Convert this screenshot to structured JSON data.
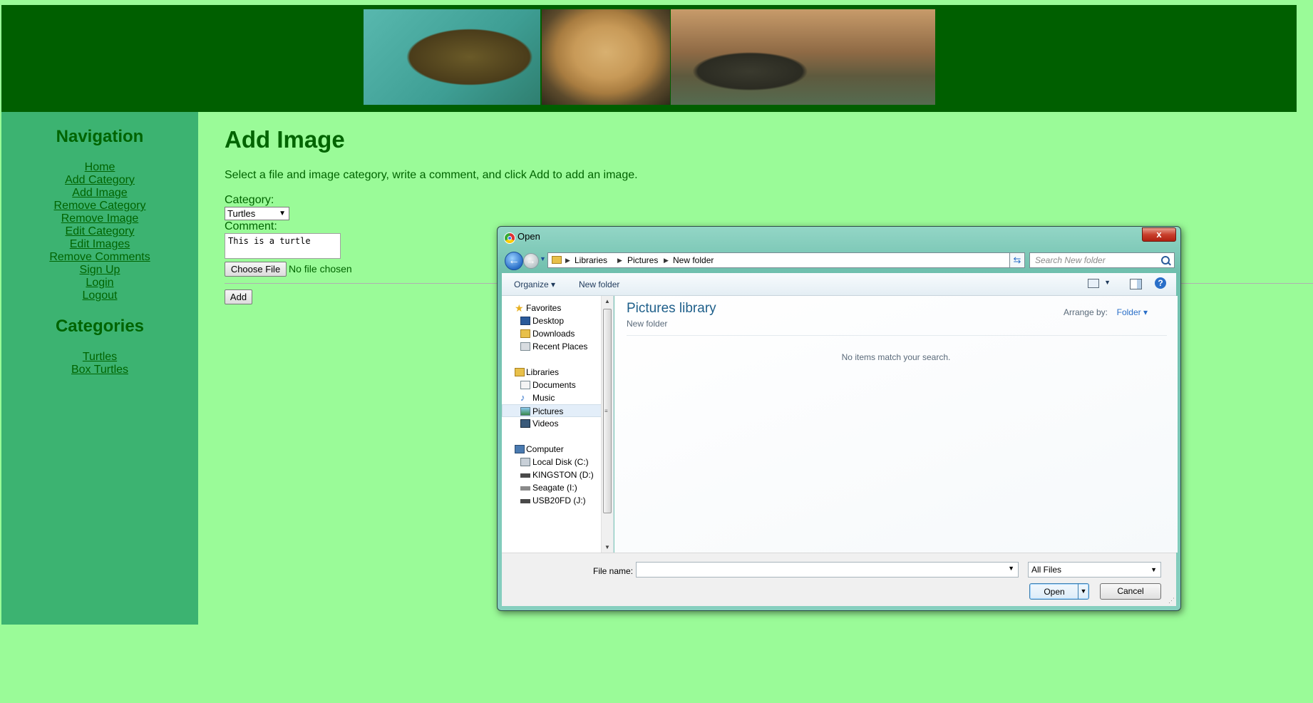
{
  "banner": {
    "photos": [
      "box-turtle-photo",
      "golden-retriever-photo",
      "painted-turtles-photo"
    ]
  },
  "sidebar": {
    "nav_heading": "Navigation",
    "nav_links": [
      "Home",
      "Add Category",
      "Add Image",
      "Remove Category",
      "Remove Image",
      "Edit Category",
      "Edit Images",
      "Remove Comments",
      "Sign Up",
      "Login",
      "Logout"
    ],
    "categories_heading": "Categories",
    "category_links": [
      "Turtles",
      "Box Turtles"
    ]
  },
  "main": {
    "title": "Add Image",
    "instructions": "Select a file and image category, write a comment, and click Add to add an image.",
    "category_label": "Category:",
    "category_value": "Turtles",
    "comment_label": "Comment:",
    "comment_value": "This is a turtle",
    "choose_file_label": "Choose File",
    "no_file_text": "No file chosen",
    "add_label": "Add"
  },
  "dialog": {
    "title": "Open",
    "close": "x",
    "breadcrumb": [
      "Libraries",
      "Pictures",
      "New folder"
    ],
    "search_placeholder": "Search New folder",
    "toolbar": {
      "organize": "Organize ▾",
      "new_folder": "New folder"
    },
    "nav_pane": {
      "favorites": "Favorites",
      "favorite_items": [
        "Desktop",
        "Downloads",
        "Recent Places"
      ],
      "libraries": "Libraries",
      "library_items": [
        "Documents",
        "Music",
        "Pictures",
        "Videos"
      ],
      "selected": "Pictures",
      "computer": "Computer",
      "drives": [
        "Local Disk (C:)",
        "KINGSTON (D:)",
        "Seagate (I:)",
        "USB20FD (J:)"
      ]
    },
    "content": {
      "library_title": "Pictures library",
      "library_subtitle": "New folder",
      "arrange_label": "Arrange by:",
      "arrange_value": "Folder ▾",
      "empty_message": "No items match your search."
    },
    "footer": {
      "filename_label": "File name:",
      "filename_value": "",
      "filetype_value": "All Files",
      "open_label": "Open",
      "cancel_label": "Cancel"
    }
  }
}
